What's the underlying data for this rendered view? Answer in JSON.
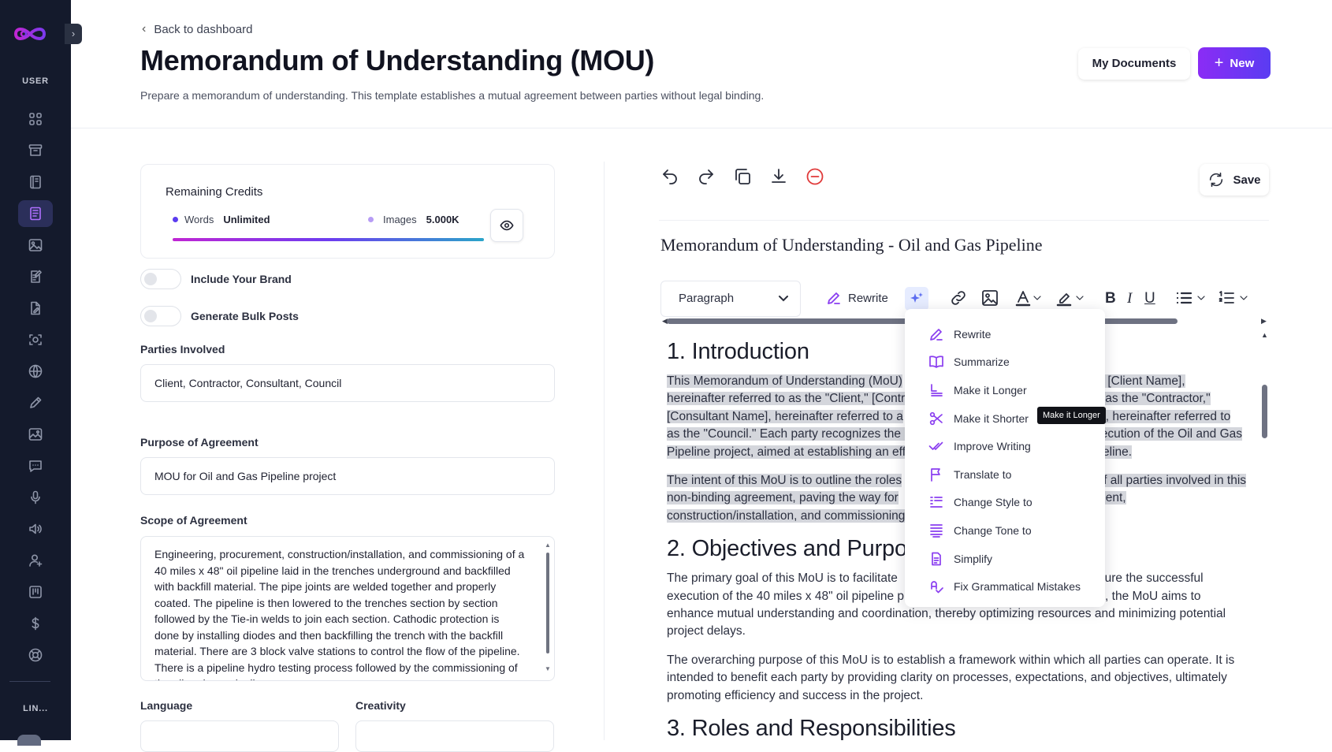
{
  "sidebar": {
    "section_user": "USER",
    "section_links": "LIN...",
    "icons": [
      "dashboard-icon",
      "archive-icon",
      "book-icon",
      "document-icon",
      "image-icon",
      "edit-document-icon",
      "file-edit-icon",
      "scan-icon",
      "www-icon",
      "pen-icon",
      "gallery-icon",
      "chat-icon",
      "microphone-icon",
      "speaker-icon",
      "user-add-icon",
      "kanban-icon",
      "dollar-icon",
      "support-icon"
    ],
    "active_index": 3
  },
  "header": {
    "back_label": "Back to dashboard",
    "title": "Memorandum of Understanding (MOU)",
    "description": "Prepare a memorandum of understanding. This template establishes a mutual agreement between parties without legal binding.",
    "my_documents": "My Documents",
    "new_label": "New"
  },
  "credits": {
    "title": "Remaining Credits",
    "words_label": "Words",
    "words_value": "Unlimited",
    "images_label": "Images",
    "images_value": "5.000K",
    "words_color": "#5b3cf0",
    "images_color": "#b79cf5"
  },
  "form": {
    "brand_toggle": "Include Your Brand",
    "bulk_toggle": "Generate Bulk Posts",
    "parties_label": "Parties Involved",
    "parties_value": "Client, Contractor, Consultant, Council",
    "purpose_label": "Purpose of Agreement",
    "purpose_value": "MOU for Oil and Gas Pipeline project",
    "scope_label": "Scope of Agreement",
    "scope_value": "Engineering, procurement, construction/installation, and commissioning of a 40 miles x 48\" oil pipeline laid in the trenches underground and backfilled with backfill material. The pipe joints are welded together and properly coated. The pipeline is then lowered to the trenches section by section followed by the Tie-in welds to join each section. Cathodic protection is done by installing diodes and then backfilling the trench with the backfill material. There are 3 block valve stations to control the flow of the pipeline. There is a pipeline hydro testing process followed by the commissioning of the oil and gas pipeline.",
    "language_label": "Language",
    "creativity_label": "Creativity"
  },
  "editor": {
    "save_label": "Save",
    "doc_title": "Memorandum of Understanding - Oil and Gas Pipeline",
    "paragraph_select": "Paragraph",
    "rewrite_label": "Rewrite",
    "h1": "1. Introduction",
    "p1_a": "This Memorandum of Understanding (MoU)",
    "p1_b": "ies: [Client Name],",
    "p1_c": "hereinafter referred to as the \"Client,\" [Contr",
    "p1_d": "as the \"Contractor,\"",
    "p1_e": "[Consultant Name], hereinafter referred to a",
    "p1_f": "e], hereinafter referred to",
    "p1_g": "as the \"Council.\" Each party recognizes the i",
    "p1_h": "ecution of the Oil and Gas",
    "p1_i": "Pipeline project, aimed at establishing an eff",
    "p1_j": "eline.",
    "p2_a": "The intent of this MoU is to outline the roles",
    "p2_b": "f all parties involved in this",
    "p2_c": "non-binding agreement, paving the way for",
    "p2_d": "ment,",
    "p2_e": "construction/installation, and commissioning",
    "h2": "2. Objectives and Purpo",
    "p3_a": "The primary goal of this MoU is to facilitate",
    "p3_b": "sure the successful",
    "p3_c": "execution of the 40 miles x 48\" oil pipeline p",
    "p3_d": ", the MoU aims to",
    "p3_e": "enhance mutual understanding and coordination, thereby optimizing resources and minimizing potential project delays.",
    "p4": "The overarching purpose of this MoU is to establish a framework within which all parties can operate. It is intended to benefit each party by providing clarity on processes, expectations, and objectives, ultimately promoting efficiency and success in the project.",
    "h3": "3. Roles and Responsibilities"
  },
  "ai_menu": {
    "items": [
      {
        "label": "Rewrite",
        "icon": "pen-icon"
      },
      {
        "label": "Summarize",
        "icon": "book-open-icon"
      },
      {
        "label": "Make it Longer",
        "icon": "lengthen-icon"
      },
      {
        "label": "Make it Shorter",
        "icon": "scissors-icon"
      },
      {
        "label": "Improve Writing",
        "icon": "double-check-icon"
      },
      {
        "label": "Translate to",
        "icon": "flag-icon"
      },
      {
        "label": "Change Style to",
        "icon": "style-icon"
      },
      {
        "label": "Change Tone to",
        "icon": "tone-icon"
      },
      {
        "label": "Simplify",
        "icon": "document-icon"
      },
      {
        "label": "Fix Grammatical Mistakes",
        "icon": "grammar-icon"
      }
    ],
    "tooltip": "Make it Longer",
    "accent": "#8a3ef0"
  }
}
